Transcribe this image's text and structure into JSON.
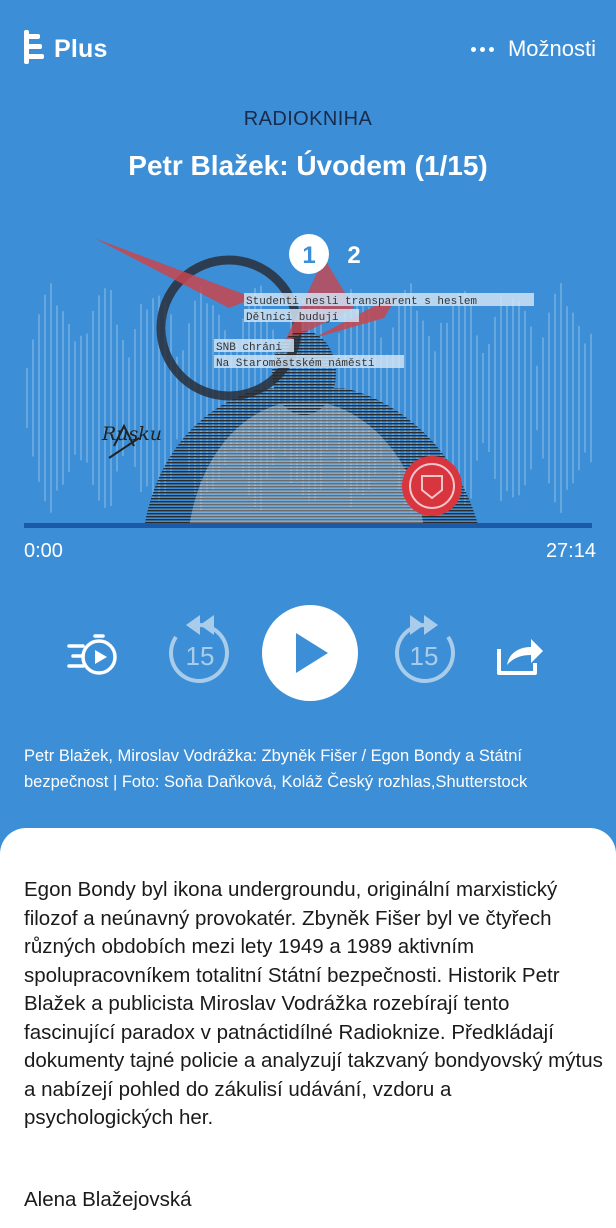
{
  "header": {
    "brand": "Plus",
    "options_label": "Možnosti"
  },
  "episode": {
    "category": "RADIOKNIHA",
    "title": "Petr Blažek: Úvodem (1/15)"
  },
  "artwork": {
    "badge_1": "1",
    "badge_2": "2",
    "note_1": "Studenti nesli transparent s heslem",
    "note_2": "Dělníci budují",
    "note_3": "SNB chrání",
    "note_4": "Na Staroměstském náměstí",
    "signature": "Rusku"
  },
  "player": {
    "elapsed": "0:00",
    "duration": "27:14",
    "progress": 0.0,
    "skip_back_seconds": "15",
    "skip_forward_seconds": "15"
  },
  "caption": "Petr Blažek, Miroslav Vodrážka: Zbyněk Fišer / Egon Bondy a Státní bezpečnost | Foto: Soňa Daňková, Koláž Český rozhlas,Shutterstock",
  "description": "Egon Bondy byl ikona undergroundu, originální marxistický filozof a neúnavný provokatér. Zbyněk Fišer byl ve čtyřech různých obdobích mezi lety 1949 a 1989 aktivním spolupracovníkem totalitní Státní bezpečnosti. Historik Petr Blažek a publicista Miroslav Vodrážka rozebírají tento fascinující paradox v patnáctidílné Radioknize. Předkládají dokumenty tajné policie a analyzují takzvaný bondyovský mýtus a nabízejí pohled do zákulisí udávání, vzdoru a psychologických her.",
  "author": "Alena Blažejovská",
  "colors": {
    "background": "#3c8fd6",
    "progress_track": "#1a5aa6",
    "panel": "#ffffff"
  }
}
